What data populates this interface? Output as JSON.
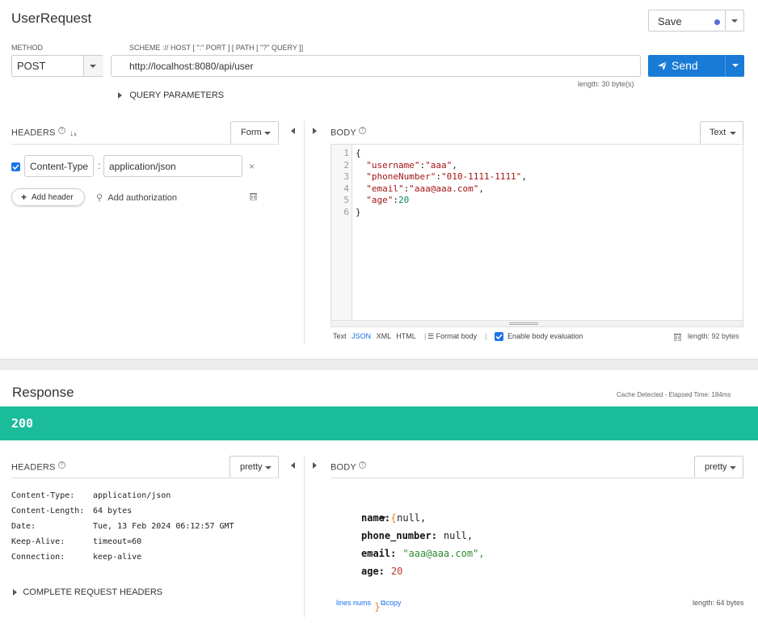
{
  "request": {
    "title": "UserRequest",
    "save_label": "Save",
    "method_label": "METHOD",
    "method_value": "POST",
    "url_label": "SCHEME :// HOST [ \":\" PORT ] [ PATH [ \"?\" QUERY ]]",
    "url_value": "http://localhost:8080/api/user",
    "send_label": "Send",
    "url_length": "length: 30 byte(s)",
    "query_params_label": "QUERY PARAMETERS",
    "headers_label": "HEADERS",
    "headers_mode": "Form",
    "header_row": {
      "name": "Content-Type",
      "value": "application/json"
    },
    "add_header_label": "Add header",
    "add_auth_label": "Add authorization",
    "body_label": "BODY",
    "body_mode": "Text",
    "body_lines": [
      {
        "num": "1",
        "text": "{"
      },
      {
        "num": "2",
        "text": "  \"username\":\"aaa\","
      },
      {
        "num": "3",
        "text": "  \"phoneNumber\":\"010-1111-1111\","
      },
      {
        "num": "4",
        "text": "  \"email\":\"aaa@aaa.com\","
      },
      {
        "num": "5",
        "text": "  \"age\":20"
      },
      {
        "num": "6",
        "text": "}"
      }
    ],
    "body_formats": [
      "Text",
      "JSON",
      "XML",
      "HTML"
    ],
    "format_body_label": "Format body",
    "enable_eval_label": "Enable body evaluation",
    "body_length": "length: 92 bytes"
  },
  "response": {
    "title": "Response",
    "meta": "Cache Detected - Elapsed Time: 184ms",
    "status": "200",
    "status_color": "#1abc9c",
    "headers_label": "HEADERS",
    "headers_mode": "pretty",
    "headers": [
      {
        "name": "Content-Type:",
        "value": "application/json"
      },
      {
        "name": "Content-Length:",
        "value": "64 bytes"
      },
      {
        "name": "Date:",
        "value": "Tue, 13 Feb 2024 06:12:57 GMT"
      },
      {
        "name": "Keep-Alive:",
        "value": "timeout=60"
      },
      {
        "name": "Connection:",
        "value": "keep-alive"
      }
    ],
    "complete_headers_label": "COMPLETE REQUEST HEADERS",
    "body_label": "BODY",
    "body_mode": "pretty",
    "json": {
      "open": "{",
      "close": "}",
      "fields": [
        {
          "key": "name:",
          "value": "null",
          "type": "null"
        },
        {
          "key": "phone_number:",
          "value": "null",
          "type": "null"
        },
        {
          "key": "email:",
          "value": "\"aaa@aaa.com\",",
          "type": "string"
        },
        {
          "key": "age:",
          "value": "20",
          "type": "number"
        }
      ]
    },
    "lines_nums_label": "lines nums",
    "copy_label": "copy",
    "body_length": "length: 64 bytes"
  }
}
